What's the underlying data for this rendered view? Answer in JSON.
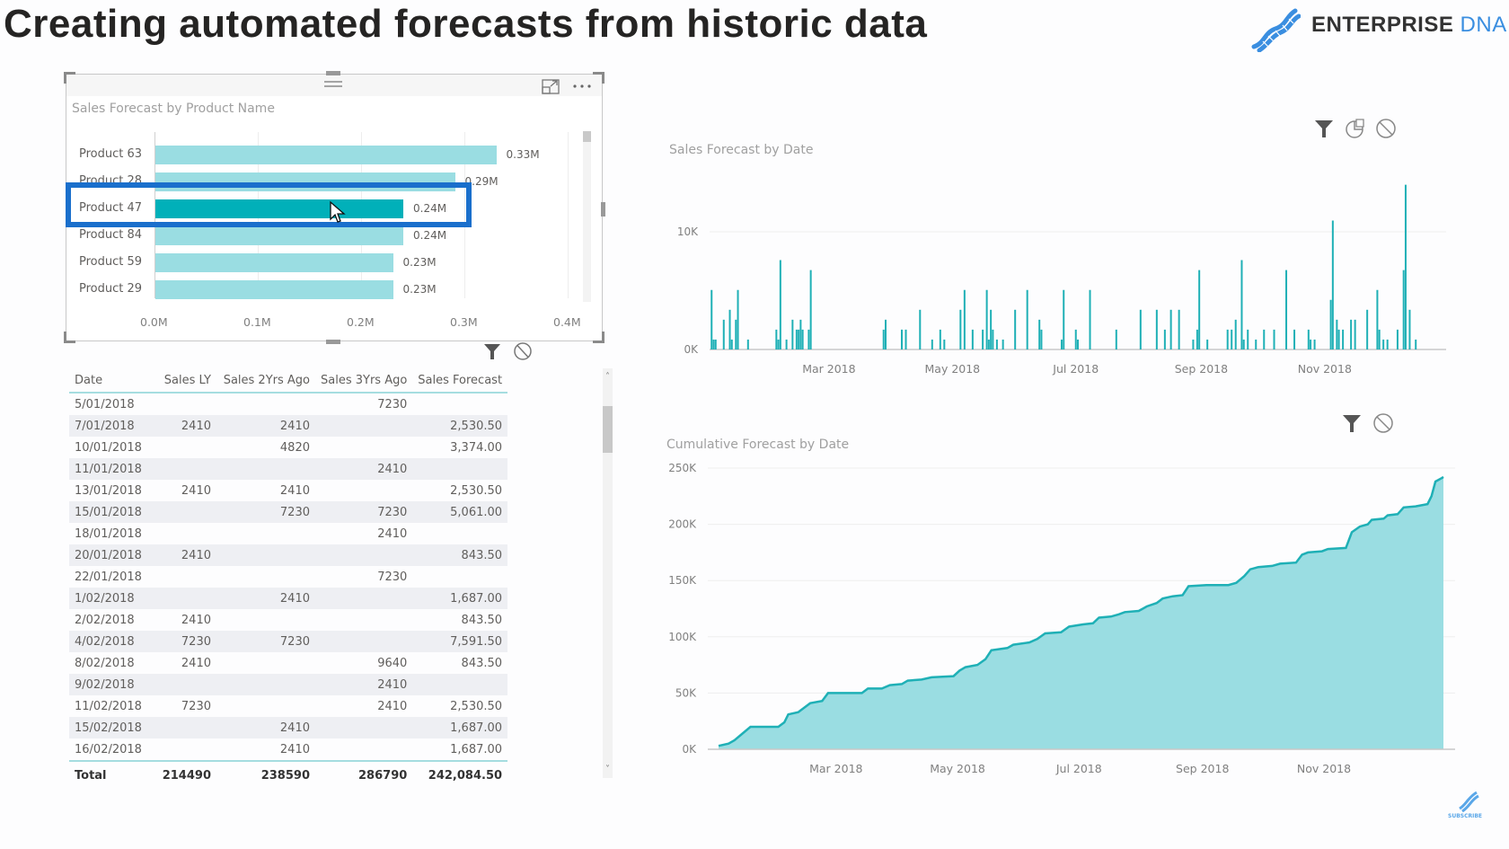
{
  "header": {
    "title": "Creating automated forecasts from historic data",
    "logo_text_main": "ENTERPRISE",
    "logo_text_accent": "DNA",
    "subscribe_label": "SUBSCRIBE"
  },
  "colors": {
    "accent_teal": "#01b0b9",
    "bar_light": "#9adde2",
    "area_fill": "#9adde2",
    "line": "#1fb0b6",
    "highlight_box": "#1a6fcc",
    "logo_blue": "#3a8ee0"
  },
  "bar_visual": {
    "title": "Sales Forecast by Product Name",
    "icons": [
      "focus-mode-icon",
      "more-options-icon",
      "drag-handle-icon"
    ],
    "filter_icons": [
      "filter-icon",
      "no-filter-icon"
    ]
  },
  "table": {
    "columns": [
      "Date",
      "Sales LY",
      "Sales 2Yrs Ago",
      "Sales 3Yrs Ago",
      "Sales Forecast"
    ],
    "rows": [
      [
        "5/01/2018",
        "",
        "",
        "7230",
        ""
      ],
      [
        "7/01/2018",
        "2410",
        "2410",
        "",
        "2,530.50"
      ],
      [
        "10/01/2018",
        "",
        "4820",
        "",
        "3,374.00"
      ],
      [
        "11/01/2018",
        "",
        "",
        "2410",
        ""
      ],
      [
        "13/01/2018",
        "2410",
        "2410",
        "",
        "2,530.50"
      ],
      [
        "15/01/2018",
        "",
        "7230",
        "7230",
        "5,061.00"
      ],
      [
        "18/01/2018",
        "",
        "",
        "2410",
        ""
      ],
      [
        "20/01/2018",
        "2410",
        "",
        "",
        "843.50"
      ],
      [
        "22/01/2018",
        "",
        "",
        "7230",
        ""
      ],
      [
        "1/02/2018",
        "",
        "2410",
        "",
        "1,687.00"
      ],
      [
        "2/02/2018",
        "2410",
        "",
        "",
        "843.50"
      ],
      [
        "4/02/2018",
        "7230",
        "7230",
        "",
        "7,591.50"
      ],
      [
        "8/02/2018",
        "2410",
        "",
        "9640",
        "843.50"
      ],
      [
        "9/02/2018",
        "",
        "",
        "2410",
        ""
      ],
      [
        "11/02/2018",
        "7230",
        "",
        "2410",
        "2,530.50"
      ],
      [
        "15/02/2018",
        "",
        "2410",
        "",
        "1,687.00"
      ],
      [
        "16/02/2018",
        "",
        "2410",
        "",
        "1,687.00"
      ]
    ],
    "total": [
      "Total",
      "214490",
      "238590",
      "286790",
      "242,084.50"
    ],
    "scroll_up": "˄",
    "scroll_down": "˅"
  },
  "chart_data": [
    {
      "type": "bar",
      "orientation": "horizontal",
      "title": "Sales Forecast by Product Name",
      "categories": [
        "Product 63",
        "Product 28",
        "Product 47",
        "Product 84",
        "Product 59",
        "Product 29"
      ],
      "values": [
        0.33,
        0.29,
        0.24,
        0.24,
        0.23,
        0.23
      ],
      "data_labels": [
        "0.33M",
        "0.29M",
        "0.24M",
        "0.24M",
        "0.23M",
        "0.23M"
      ],
      "selected": "Product 47",
      "unit": "M",
      "xlim": [
        0,
        0.4
      ],
      "xticks": [
        "0.0M",
        "0.1M",
        "0.2M",
        "0.3M",
        "0.4M"
      ],
      "grid": true
    },
    {
      "type": "line",
      "title": "Sales Forecast by Date",
      "ylabel": "",
      "xlabel": "",
      "ylim": [
        0,
        15000
      ],
      "yticks": [
        {
          "v": 0,
          "label": "0K"
        },
        {
          "v": 10000,
          "label": "10K"
        }
      ],
      "xticks": [
        "Mar 2018",
        "May 2018",
        "Jul 2018",
        "Sep 2018",
        "Nov 2018"
      ],
      "xdomain_days": [
        0,
        364
      ],
      "xtick_days": [
        59,
        120,
        181,
        243,
        304
      ],
      "spikes": [
        [
          1,
          5061
        ],
        [
          2,
          843
        ],
        [
          3,
          843
        ],
        [
          7,
          2530
        ],
        [
          10,
          3374
        ],
        [
          11,
          843
        ],
        [
          13,
          2530
        ],
        [
          14,
          5061
        ],
        [
          19,
          843
        ],
        [
          33,
          1687
        ],
        [
          34,
          843
        ],
        [
          35,
          7591
        ],
        [
          38,
          843
        ],
        [
          41,
          2530
        ],
        [
          43,
          1687
        ],
        [
          44,
          1687
        ],
        [
          45,
          2530
        ],
        [
          46,
          1687
        ],
        [
          49,
          1687
        ],
        [
          50,
          6747
        ],
        [
          86,
          1687
        ],
        [
          87,
          2530
        ],
        [
          95,
          1687
        ],
        [
          97,
          1687
        ],
        [
          104,
          3374
        ],
        [
          110,
          843
        ],
        [
          114,
          1687
        ],
        [
          116,
          843
        ],
        [
          124,
          3374
        ],
        [
          126,
          5061
        ],
        [
          130,
          1687
        ],
        [
          135,
          1687
        ],
        [
          137,
          5061
        ],
        [
          138,
          843
        ],
        [
          139,
          3374
        ],
        [
          140,
          1687
        ],
        [
          142,
          843
        ],
        [
          145,
          843
        ],
        [
          151,
          3374
        ],
        [
          157,
          5061
        ],
        [
          163,
          2530
        ],
        [
          164,
          1687
        ],
        [
          174,
          843
        ],
        [
          175,
          5061
        ],
        [
          181,
          1687
        ],
        [
          182,
          843
        ],
        [
          188,
          5061
        ],
        [
          201,
          1687
        ],
        [
          213,
          3374
        ],
        [
          221,
          3374
        ],
        [
          225,
          1687
        ],
        [
          228,
          3374
        ],
        [
          232,
          3374
        ],
        [
          239,
          843
        ],
        [
          241,
          1687
        ],
        [
          242,
          6747
        ],
        [
          246,
          843
        ],
        [
          256,
          1687
        ],
        [
          258,
          1687
        ],
        [
          260,
          2530
        ],
        [
          263,
          7591
        ],
        [
          264,
          843
        ],
        [
          266,
          1687
        ],
        [
          270,
          843
        ],
        [
          274,
          1687
        ],
        [
          279,
          1687
        ],
        [
          285,
          6747
        ],
        [
          289,
          1687
        ],
        [
          296,
          1687
        ],
        [
          297,
          843
        ],
        [
          299,
          843
        ],
        [
          307,
          4216
        ],
        [
          308,
          10950
        ],
        [
          310,
          2530
        ],
        [
          311,
          1687
        ],
        [
          313,
          1687
        ],
        [
          317,
          2530
        ],
        [
          319,
          2530
        ],
        [
          325,
          3374
        ],
        [
          330,
          5061
        ],
        [
          331,
          1687
        ],
        [
          333,
          843
        ],
        [
          335,
          843
        ],
        [
          340,
          1687
        ],
        [
          343,
          6747
        ],
        [
          344,
          14000
        ],
        [
          346,
          3374
        ],
        [
          349,
          843
        ]
      ]
    },
    {
      "type": "area",
      "title": "Cumulative Forecast by Date",
      "ylim": [
        0,
        250000
      ],
      "yticks": [
        {
          "v": 0,
          "label": "0K"
        },
        {
          "v": 50000,
          "label": "50K"
        },
        {
          "v": 100000,
          "label": "100K"
        },
        {
          "v": 150000,
          "label": "150K"
        },
        {
          "v": 200000,
          "label": "200K"
        },
        {
          "v": 250000,
          "label": "250K"
        }
      ],
      "xticks": [
        "Mar 2018",
        "May 2018",
        "Jul 2018",
        "Sep 2018",
        "Nov 2018"
      ],
      "xdomain_days": [
        0,
        364
      ],
      "xtick_days": [
        59,
        120,
        181,
        243,
        304
      ],
      "points": [
        [
          0,
          3000
        ],
        [
          5,
          5000
        ],
        [
          8,
          8000
        ],
        [
          12,
          14000
        ],
        [
          16,
          20000
        ],
        [
          30,
          20000
        ],
        [
          33,
          24000
        ],
        [
          35,
          31000
        ],
        [
          40,
          33000
        ],
        [
          43,
          37000
        ],
        [
          46,
          41000
        ],
        [
          52,
          43000
        ],
        [
          55,
          50000
        ],
        [
          72,
          50000
        ],
        [
          75,
          54000
        ],
        [
          82,
          54000
        ],
        [
          86,
          57000
        ],
        [
          92,
          58000
        ],
        [
          95,
          61000
        ],
        [
          102,
          62000
        ],
        [
          107,
          64000
        ],
        [
          118,
          65000
        ],
        [
          121,
          70000
        ],
        [
          124,
          73000
        ],
        [
          130,
          75000
        ],
        [
          134,
          80000
        ],
        [
          137,
          88000
        ],
        [
          145,
          90000
        ],
        [
          148,
          93000
        ],
        [
          156,
          95000
        ],
        [
          160,
          98000
        ],
        [
          164,
          103000
        ],
        [
          172,
          104000
        ],
        [
          176,
          109000
        ],
        [
          183,
          111000
        ],
        [
          188,
          112000
        ],
        [
          191,
          117000
        ],
        [
          197,
          118000
        ],
        [
          201,
          120000
        ],
        [
          204,
          122000
        ],
        [
          211,
          123000
        ],
        [
          215,
          127000
        ],
        [
          220,
          130000
        ],
        [
          223,
          134000
        ],
        [
          228,
          136000
        ],
        [
          233,
          137000
        ],
        [
          236,
          145000
        ],
        [
          245,
          146000
        ],
        [
          256,
          146000
        ],
        [
          260,
          148000
        ],
        [
          264,
          154000
        ],
        [
          267,
          160000
        ],
        [
          271,
          162000
        ],
        [
          278,
          163000
        ],
        [
          282,
          165000
        ],
        [
          290,
          166000
        ],
        [
          293,
          173000
        ],
        [
          296,
          175000
        ],
        [
          303,
          176000
        ],
        [
          306,
          178000
        ],
        [
          315,
          179000
        ],
        [
          318,
          193000
        ],
        [
          322,
          198000
        ],
        [
          326,
          200000
        ],
        [
          328,
          204000
        ],
        [
          334,
          205000
        ],
        [
          336,
          208000
        ],
        [
          341,
          209000
        ],
        [
          344,
          215000
        ],
        [
          350,
          216000
        ],
        [
          356,
          218000
        ],
        [
          358,
          225000
        ],
        [
          360,
          238000
        ],
        [
          363,
          241000
        ],
        [
          364,
          242084
        ]
      ],
      "filter_icons": [
        "filter-icon",
        "no-filter-icon"
      ]
    }
  ],
  "line_visual": {
    "filter_icons": [
      "filter-icon",
      "focus-icon",
      "no-filter-icon"
    ]
  }
}
